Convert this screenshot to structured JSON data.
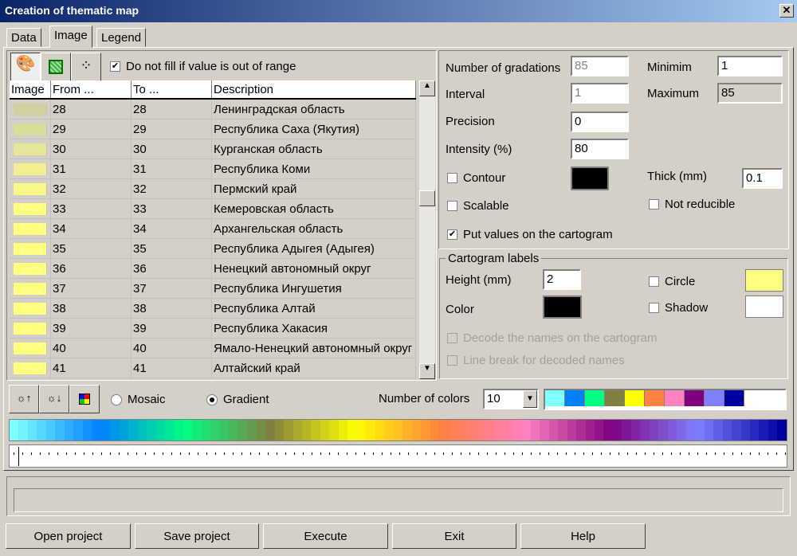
{
  "window": {
    "title": "Creation of thematic map",
    "close": "✕"
  },
  "tabs": [
    {
      "label": "Data"
    },
    {
      "label": "Image"
    },
    {
      "label": "Legend"
    }
  ],
  "toolbar": {
    "no_fill_label": "Do not fill if value is out of range",
    "no_fill_checked": true
  },
  "table": {
    "headers": [
      "Image",
      "From ...",
      "To ...",
      "Description"
    ],
    "rows": [
      {
        "color": "#d0d0a0",
        "from": "28",
        "to": "28",
        "desc": "Ленинградская область"
      },
      {
        "color": "#dcdc9a",
        "from": "29",
        "to": "29",
        "desc": "Республика Саха (Якутия)"
      },
      {
        "color": "#e6e698",
        "from": "30",
        "to": "30",
        "desc": "Курганская область"
      },
      {
        "color": "#f0f090",
        "from": "31",
        "to": "31",
        "desc": "Республика Коми"
      },
      {
        "color": "#f8f888",
        "from": "32",
        "to": "32",
        "desc": "Пермский край"
      },
      {
        "color": "#ffff80",
        "from": "33",
        "to": "33",
        "desc": "Кемеровская область"
      },
      {
        "color": "#ffff80",
        "from": "34",
        "to": "34",
        "desc": "Архангельская область"
      },
      {
        "color": "#ffff80",
        "from": "35",
        "to": "35",
        "desc": "Республика Адыгея (Адыгея)"
      },
      {
        "color": "#ffff80",
        "from": "36",
        "to": "36",
        "desc": "Ненецкий автономный округ"
      },
      {
        "color": "#ffff80",
        "from": "37",
        "to": "37",
        "desc": "Республика Ингушетия"
      },
      {
        "color": "#ffff80",
        "from": "38",
        "to": "38",
        "desc": "Республика Алтай"
      },
      {
        "color": "#ffff80",
        "from": "39",
        "to": "39",
        "desc": "Республика Хакасия"
      },
      {
        "color": "#ffff80",
        "from": "40",
        "to": "40",
        "desc": "Ямало-Ненецкий автономный округ"
      },
      {
        "color": "#ffff80",
        "from": "41",
        "to": "41",
        "desc": "Алтайский край"
      }
    ]
  },
  "settings": {
    "gradations_label": "Number of gradations",
    "gradations": "85",
    "interval_label": "Interval",
    "interval": "1",
    "precision_label": "Precision",
    "precision": "0",
    "intensity_label": "Intensity (%)",
    "intensity": "80",
    "min_label": "Minimim",
    "min": "1",
    "max_label": "Maximum",
    "max": "85",
    "contour_label": "Contour",
    "contour_color": "#000000",
    "thick_label": "Thick (mm)",
    "thick": "0.1",
    "scalable_label": "Scalable",
    "not_reducible_label": "Not reducible",
    "put_values_label": "Put values on the cartogram",
    "put_values_checked": true
  },
  "labels": {
    "group": "Cartogram labels",
    "height_label": "Height (mm)",
    "height": "2",
    "color_label": "Color",
    "color": "#000000",
    "circle_label": "Circle",
    "circle_color": "#ffff80",
    "shadow_label": "Shadow",
    "shadow_color": "#ffffff",
    "decode_label": "Decode the names on the cartogram",
    "linebreak_label": "Line break for decoded names"
  },
  "palette": {
    "mosaic_label": "Mosaic",
    "gradient_label": "Gradient",
    "selected": "Gradient",
    "num_colors_label": "Number of colors",
    "num_colors": "10",
    "colors": [
      "#80ffff",
      "#0080ff",
      "#00ff80",
      "#808040",
      "#ffff00",
      "#ff8040",
      "#ff80c0",
      "#800080",
      "#8080ff",
      "#0000a0"
    ],
    "steps": 85
  },
  "buttons": {
    "open": "Open project",
    "save": "Save project",
    "execute": "Execute",
    "exit": "Exit",
    "help": "Help"
  }
}
